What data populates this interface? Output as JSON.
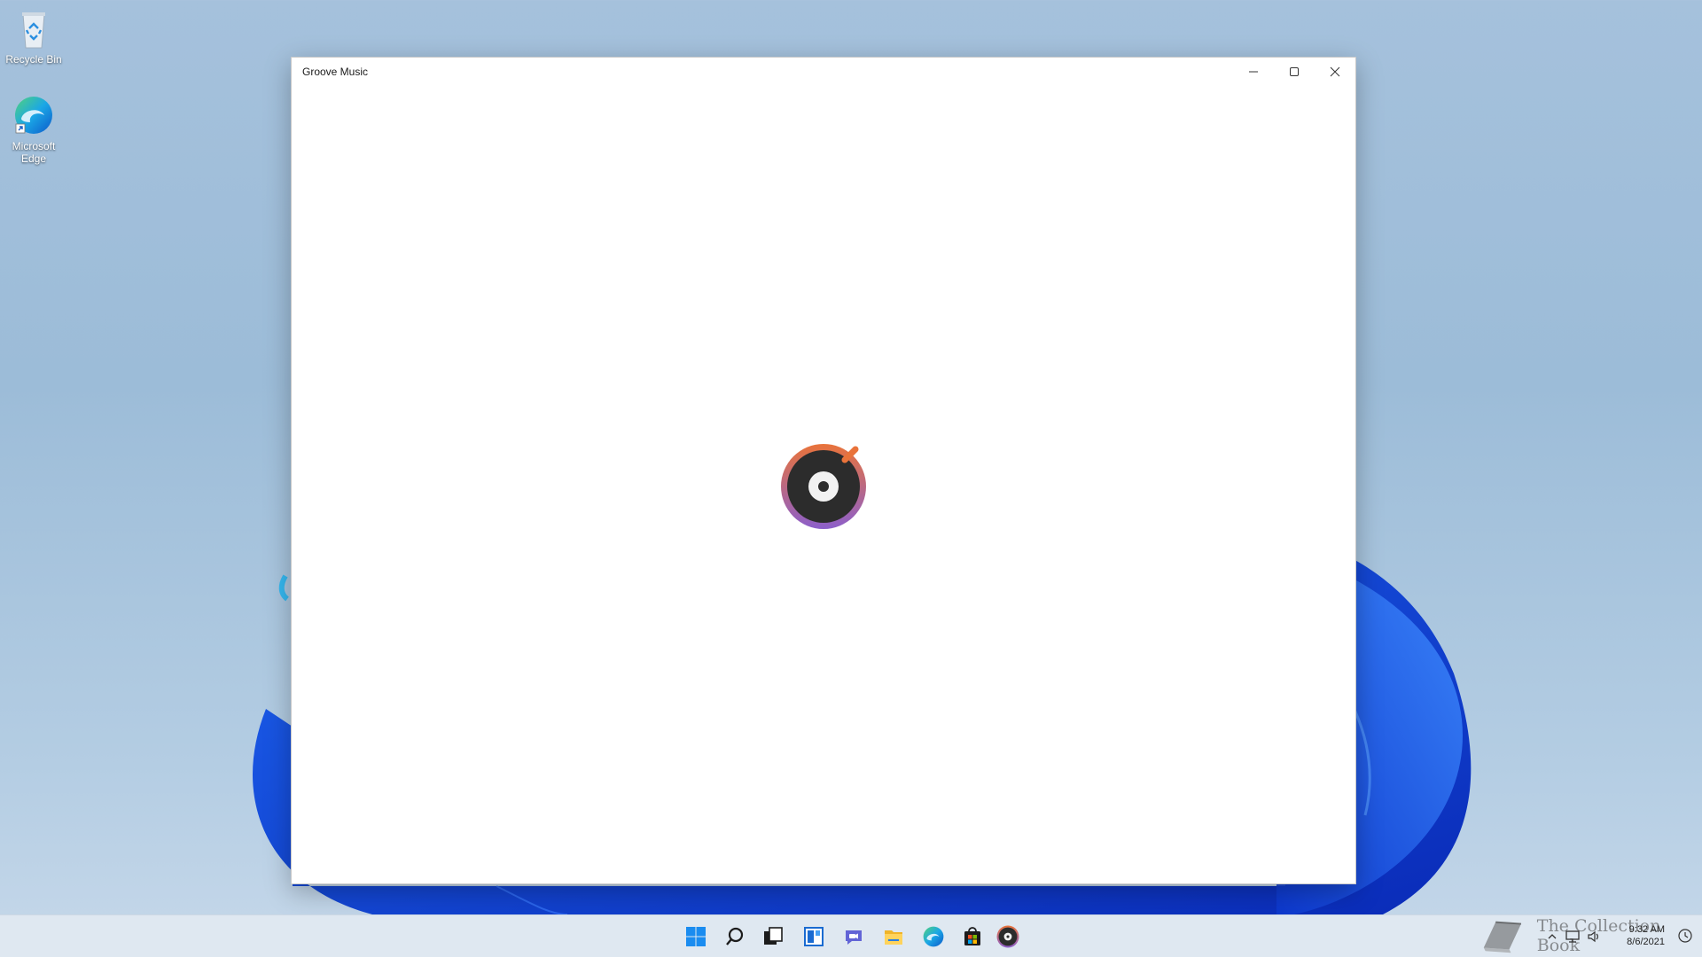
{
  "desktop": {
    "icons": [
      {
        "label": "Recycle Bin",
        "icon": "recycle-bin-icon"
      },
      {
        "label": "Microsoft Edge",
        "icon": "edge-icon"
      }
    ]
  },
  "window": {
    "title": "Groove Music",
    "minimize_icon": "minimize-icon",
    "maximize_icon": "maximize-icon",
    "close_icon": "close-icon",
    "splash_icon": "groove-music-logo"
  },
  "taskbar": {
    "icons": [
      "start-icon",
      "search-icon",
      "task-view-icon",
      "widgets-icon",
      "teams-chat-icon",
      "file-explorer-icon",
      "edge-icon",
      "store-icon",
      "groove-music-icon"
    ],
    "tray_icons": [
      "chevron-up-icon",
      "network-icon",
      "volume-icon"
    ],
    "time": "9:32 AM",
    "date": "8/6/2021",
    "notification_icon": "notification-icon"
  },
  "watermark": {
    "text": "The Collection Book",
    "icon": "book-icon"
  },
  "colors": {
    "wallpaper": "#a5c1dc",
    "bloom": "#0f3fd6",
    "taskbar": "#dfe8f1",
    "groove_orange": "#e0703a",
    "groove_purple": "#8b5fc7"
  }
}
